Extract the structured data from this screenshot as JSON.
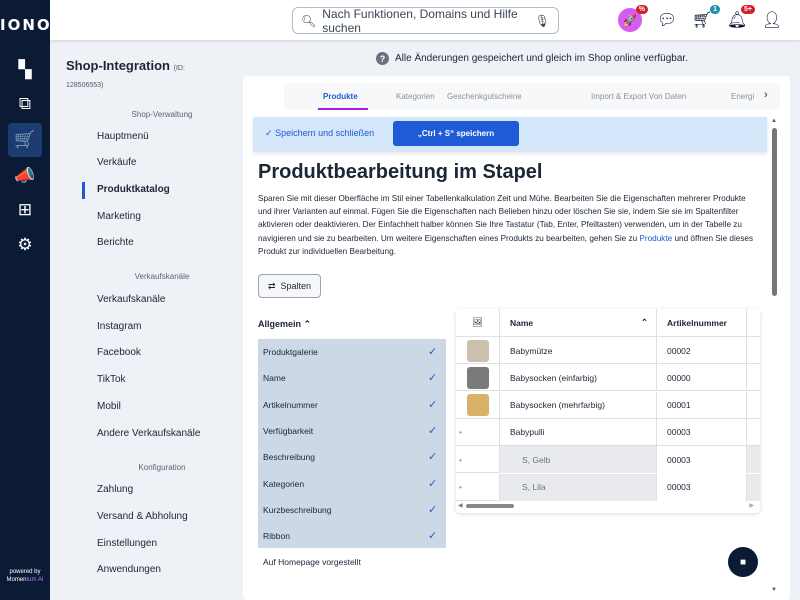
{
  "brand": "IONOS",
  "powered": {
    "line1": "powered by",
    "line2a": "Momen",
    "line2b": "tum AI"
  },
  "rail": [
    {
      "icon": "dashboard-icon",
      "glyph": "▚"
    },
    {
      "icon": "devices-icon",
      "glyph": "⧉"
    },
    {
      "icon": "cart-icon",
      "glyph": "🛒",
      "active": true
    },
    {
      "icon": "marketing-icon",
      "glyph": "📣"
    },
    {
      "icon": "add-apps-icon",
      "glyph": "⊞"
    },
    {
      "icon": "settings-icon",
      "glyph": "⚙"
    }
  ],
  "search": {
    "placeholder": "Nach Funktionen, Domains und Hilfe suchen"
  },
  "topIcons": {
    "promo_badge": "%",
    "cart_badge": "1",
    "bell_badge": "5+"
  },
  "colors": {
    "navy": "#0b1a35",
    "accent": "#1f5bd6",
    "tab_underline": "#a222e0"
  },
  "panel": {
    "title": "Shop-Integration",
    "id_label": "(ID:",
    "id_value": "128506553)",
    "sections": [
      {
        "header": "Shop-Verwaltung",
        "items": [
          "Hauptmenü",
          "Verkäufe",
          "Produktkatalog",
          "Marketing",
          "Berichte"
        ]
      },
      {
        "header": "Verkaufskanäle",
        "items": [
          "Verkaufskanäle",
          "Instagram",
          "Facebook",
          "TikTok",
          "Mobil",
          "Andere Verkaufskanäle"
        ]
      },
      {
        "header": "Konfiguration",
        "items": [
          "Zahlung",
          "Versand & Abholung",
          "Einstellungen",
          "Anwendungen"
        ]
      }
    ],
    "active": "Produktkatalog"
  },
  "notice": "Alle Änderungen gespeichert und gleich im Shop online verfügbar.",
  "tabs": [
    "Produkte",
    "Kategorien",
    "Geschenkgutscheine",
    "Import & Export Von Daten",
    "Energi"
  ],
  "savebar": {
    "save_close": "Speichern und schließen",
    "ctrl_save": "„Ctrl + S“ speichern"
  },
  "main": {
    "title": "Produktbearbeitung im Stapel",
    "desc": "Sparen Sie mit dieser Oberfläche im Stil einer Tabellenkalkulation Zeit und Mühe. Bearbeiten Sie die Eigenschaften mehrerer Produkte und ihrer Varianten auf einmal. Fügen Sie die Eigenschaften nach Belieben hinzu oder löschen Sie sie, indem Sie sie im Spaltenfilter aktivieren oder deaktivieren. Der Einfachheit halber können Sie Ihre Tastatur (Tab, Enter, Pfeiltasten) verwenden, um in der Tabelle zu navigieren und sie zu bearbeiten. Um weitere Eigenschaften eines Produkts zu bearbeiten, gehen Sie zu ",
    "desc_link": "Produkte",
    "desc_end": " und öffnen Sie dieses Produkt zur individuellen Bearbeitung.",
    "columns_button": "Spalten",
    "group": "Allgemein",
    "column_options": [
      "Produktgalerie",
      "Name",
      "Artikelnummer",
      "Verfügbarkeit",
      "Beschreibung",
      "Kategorien",
      "Kurzbeschreibung",
      "Ribbon"
    ],
    "unchecked_option": "Auf Homepage vorgestellt"
  },
  "table": {
    "headers": [
      "Name",
      "Artikelnummer"
    ],
    "rows": [
      {
        "name": "Babymütze",
        "sku": "00002",
        "thumb": "#cbbfae"
      },
      {
        "name": "Babysocken (einfarbig)",
        "sku": "00000",
        "thumb": "#7a7a78"
      },
      {
        "name": "Babysocken (mehrfarbig)",
        "sku": "00001",
        "thumb": "#d9b26a"
      },
      {
        "name": "Babypulli",
        "sku": "00003"
      },
      {
        "name": "S, Gelb",
        "sku": "00003",
        "variant": true
      },
      {
        "name": "S, Lila",
        "sku": "00003",
        "variant": true
      }
    ]
  }
}
